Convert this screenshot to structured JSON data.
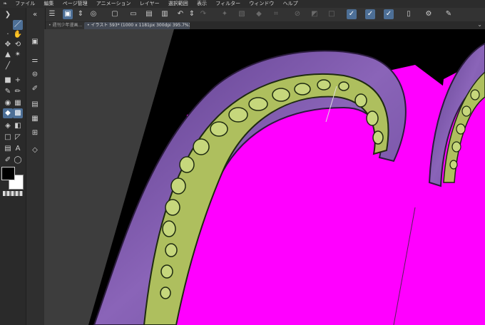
{
  "menubar": {
    "logo": "❧",
    "items": [
      "ファイル",
      "編集",
      "ページ管理",
      "アニメーション",
      "レイヤー",
      "選択範囲",
      "表示",
      "フィルター",
      "ウィンドウ",
      "ヘルプ"
    ]
  },
  "tabs": [
    {
      "label": "• 週刊少年漫画…",
      "active": false
    },
    {
      "label": "• イラスト 593* (1000 x 1181px 300dpi 395.7%)",
      "active": true
    }
  ],
  "colors": {
    "magenta": "#ff00ff",
    "tentacle_purple": "#7a52a8",
    "sucker_green": "#b8cc6a",
    "accent": "#4d6f96"
  },
  "canvas": {
    "zoom": "395.7%"
  }
}
